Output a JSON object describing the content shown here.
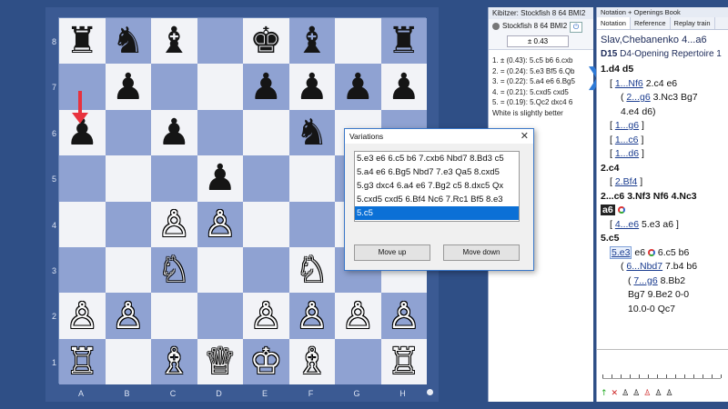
{
  "board": {
    "ranks": [
      "8",
      "7",
      "6",
      "5",
      "4",
      "3",
      "2",
      "1"
    ],
    "files": [
      "A",
      "B",
      "C",
      "D",
      "E",
      "F",
      "G",
      "H"
    ],
    "squares": [
      [
        {
          "p": "♜",
          "c": "b"
        },
        {
          "p": "♞",
          "c": "b"
        },
        {
          "p": "♝",
          "c": "b"
        },
        {
          "p": "",
          "c": ""
        },
        {
          "p": "♚",
          "c": "b"
        },
        {
          "p": "♝",
          "c": "b"
        },
        {
          "p": "",
          "c": ""
        },
        {
          "p": "♜",
          "c": "b"
        }
      ],
      [
        {
          "p": "",
          "c": ""
        },
        {
          "p": "♟",
          "c": "b"
        },
        {
          "p": "",
          "c": ""
        },
        {
          "p": "",
          "c": ""
        },
        {
          "p": "♟",
          "c": "b"
        },
        {
          "p": "♟",
          "c": "b"
        },
        {
          "p": "♟",
          "c": "b"
        },
        {
          "p": "♟",
          "c": "b"
        }
      ],
      [
        {
          "p": "♟",
          "c": "b"
        },
        {
          "p": "",
          "c": ""
        },
        {
          "p": "♟",
          "c": "b"
        },
        {
          "p": "",
          "c": ""
        },
        {
          "p": "",
          "c": ""
        },
        {
          "p": "♞",
          "c": "b"
        },
        {
          "p": "",
          "c": ""
        },
        {
          "p": "",
          "c": ""
        }
      ],
      [
        {
          "p": "",
          "c": ""
        },
        {
          "p": "",
          "c": ""
        },
        {
          "p": "",
          "c": ""
        },
        {
          "p": "♟",
          "c": "b"
        },
        {
          "p": "",
          "c": ""
        },
        {
          "p": "",
          "c": ""
        },
        {
          "p": "",
          "c": ""
        },
        {
          "p": "",
          "c": ""
        }
      ],
      [
        {
          "p": "",
          "c": ""
        },
        {
          "p": "",
          "c": ""
        },
        {
          "p": "♙",
          "c": "w"
        },
        {
          "p": "♙",
          "c": "w"
        },
        {
          "p": "",
          "c": ""
        },
        {
          "p": "",
          "c": ""
        },
        {
          "p": "",
          "c": ""
        },
        {
          "p": "",
          "c": ""
        }
      ],
      [
        {
          "p": "",
          "c": ""
        },
        {
          "p": "",
          "c": ""
        },
        {
          "p": "♘",
          "c": "w"
        },
        {
          "p": "",
          "c": ""
        },
        {
          "p": "",
          "c": ""
        },
        {
          "p": "♘",
          "c": "w"
        },
        {
          "p": "",
          "c": ""
        },
        {
          "p": "",
          "c": ""
        }
      ],
      [
        {
          "p": "♙",
          "c": "w"
        },
        {
          "p": "♙",
          "c": "w"
        },
        {
          "p": "",
          "c": ""
        },
        {
          "p": "",
          "c": ""
        },
        {
          "p": "♙",
          "c": "w"
        },
        {
          "p": "♙",
          "c": "w"
        },
        {
          "p": "♙",
          "c": "w"
        },
        {
          "p": "♙",
          "c": "w"
        }
      ],
      [
        {
          "p": "♖",
          "c": "w"
        },
        {
          "p": "",
          "c": ""
        },
        {
          "p": "♗",
          "c": "w"
        },
        {
          "p": "♕",
          "c": "w"
        },
        {
          "p": "♔",
          "c": "w"
        },
        {
          "p": "♗",
          "c": "w"
        },
        {
          "p": "",
          "c": ""
        },
        {
          "p": "♖",
          "c": "w"
        }
      ]
    ],
    "colors": {
      "light": "#f2f3f7",
      "dark": "#8fa2d2",
      "arrow": "#e8323e"
    }
  },
  "kibitzer": {
    "title": "Kibitzer: Stockfish 8 64 BMI2",
    "engine_label": "Stockfish 8 64 BMI2",
    "eval": "± 0.43",
    "lines": [
      "1. ± (0.43): 5.c5 b6 6.cxb",
      "2. = (0.24): 5.e3 Bf5 6.Qb",
      "3. = (0.22): 5.a4 e6 6.Bg5",
      "4. = (0.21): 5.cxd5 cxd5",
      "5. = (0.19): 5.Qc2 dxc4 6",
      "White is slightly better"
    ]
  },
  "notation": {
    "title": "Notation + Openings Book",
    "tabs": [
      "Notation",
      "Reference",
      "Replay train"
    ],
    "game_head": "Slav,Chebanenko 4...a6",
    "opening_code": "D15",
    "opening_name": "D4-Opening Repertoire 1",
    "lines": {
      "l1": "1.d4  d5",
      "l2a": "1...Nf6",
      "l2b": " 2.c4  e6",
      "l3a": "2...g6",
      "l3b": " 3.Nc3  Bg7",
      "l4": "4.e4  d6",
      "l5": "1...g6",
      "l6": "1...c6",
      "l7": "1...d6",
      "l8": "2.c4",
      "l9": "2.Bf4",
      "l10": "2...c6  3.Nf3  Nf6  4.Nc3",
      "l11_hl": "a6",
      "l12a": "4...e6",
      "l12b": " 5.e3  a6",
      "l13": "5.c5",
      "l14a": "5.e3",
      "l14b": " e6",
      "l14c": " 6.c5  b6",
      "l15a": "6...Nbd7",
      "l15b": " 7.b4  b6",
      "l16a": "7...g6",
      "l16b": " 8.Bb2",
      "l17": "Bg7  9.Be2  0-0",
      "l18": "10.0-0  Qc7"
    }
  },
  "variations": {
    "title": "Variations",
    "close": "✕",
    "items": [
      "5.e3 e6 6.c5 b6 7.cxb6 Nbd7 8.Bd3 c5",
      "5.a4 e6 6.Bg5 Nbd7 7.e3 Qa5 8.cxd5",
      "5.g3 dxc4 6.a4 e6 7.Bg2 c5 8.dxc5 Qx",
      "5.cxd5 cxd5 6.Bf4 Nc6 7.Rc1 Bf5 8.e3",
      "5.c5"
    ],
    "selected_index": 4,
    "move_up": "Move up",
    "move_down": "Move down"
  }
}
